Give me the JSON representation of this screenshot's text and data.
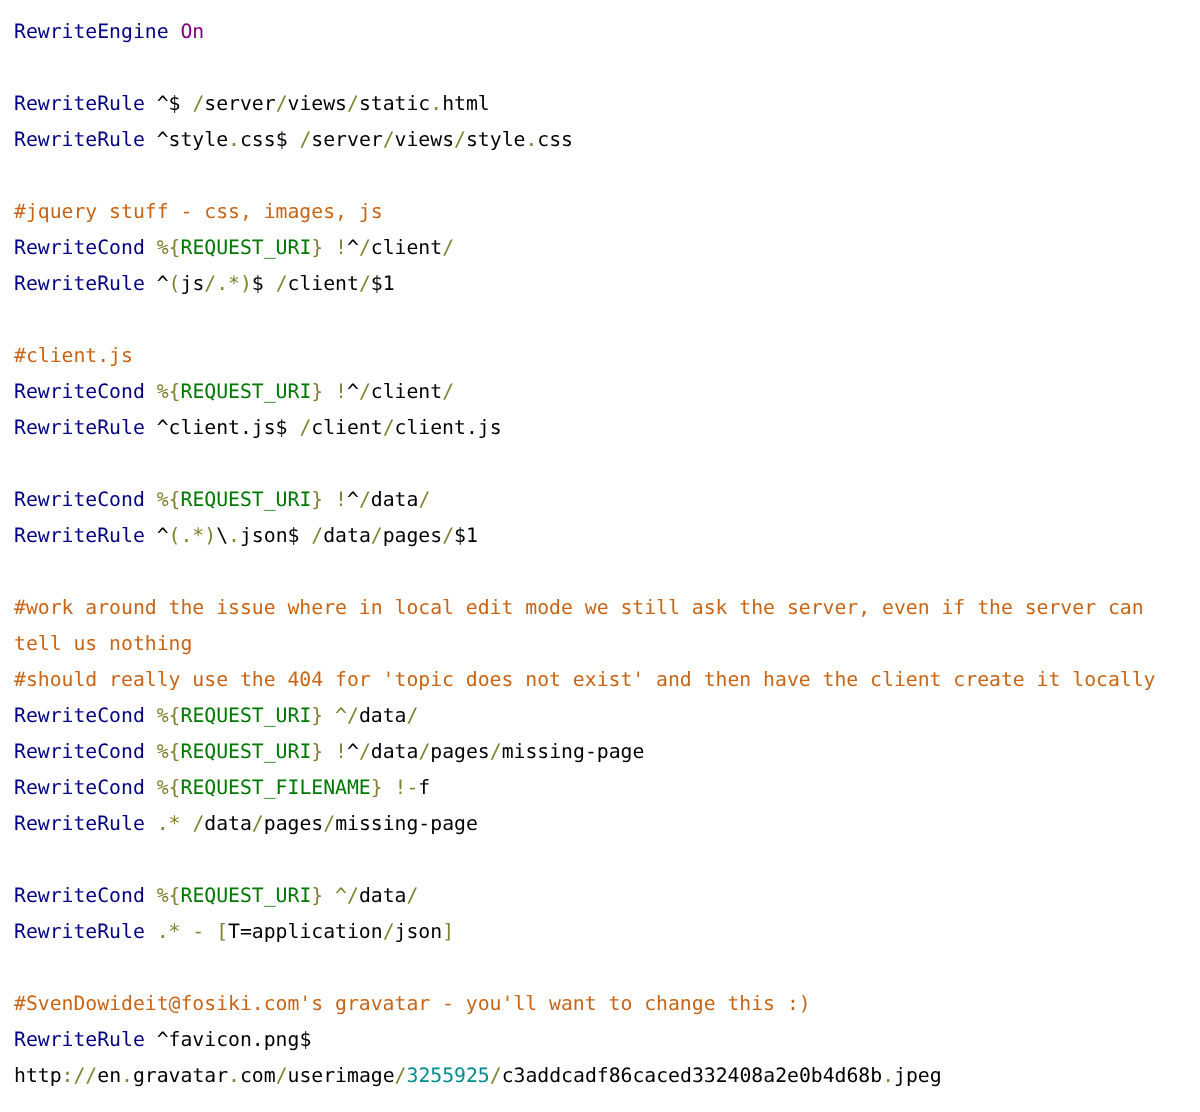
{
  "blocks": [
    {
      "lines": [
        {
          "tokens": [
            {
              "kind": "directive",
              "text": "RewriteEngine"
            },
            {
              "kind": "constant",
              "text": "On",
              "space": true
            }
          ]
        }
      ]
    },
    {
      "lines": [
        {
          "tokens": [
            {
              "kind": "directive",
              "text": "RewriteRule"
            },
            {
              "kind": "text",
              "text": " ^$ "
            },
            {
              "kind": "punct",
              "text": "/"
            },
            {
              "kind": "text",
              "text": "server"
            },
            {
              "kind": "punct",
              "text": "/"
            },
            {
              "kind": "text",
              "text": "views"
            },
            {
              "kind": "punct",
              "text": "/"
            },
            {
              "kind": "text",
              "text": "static"
            },
            {
              "kind": "punct",
              "text": "."
            },
            {
              "kind": "text",
              "text": "html"
            }
          ]
        },
        {
          "tokens": [
            {
              "kind": "directive",
              "text": "RewriteRule"
            },
            {
              "kind": "text",
              "text": " ^style"
            },
            {
              "kind": "punct",
              "text": "."
            },
            {
              "kind": "text",
              "text": "css$ "
            },
            {
              "kind": "punct",
              "text": "/"
            },
            {
              "kind": "text",
              "text": "server"
            },
            {
              "kind": "punct",
              "text": "/"
            },
            {
              "kind": "text",
              "text": "views"
            },
            {
              "kind": "punct",
              "text": "/"
            },
            {
              "kind": "text",
              "text": "style"
            },
            {
              "kind": "punct",
              "text": "."
            },
            {
              "kind": "text",
              "text": "css"
            }
          ]
        }
      ]
    },
    {
      "lines": [
        {
          "tokens": [
            {
              "kind": "comment",
              "text": "#jquery stuff - css, images, js"
            }
          ]
        },
        {
          "tokens": [
            {
              "kind": "directive",
              "text": "RewriteCond"
            },
            {
              "kind": "punct",
              "text": "%{",
              "space": true
            },
            {
              "kind": "variable",
              "text": "REQUEST_URI"
            },
            {
              "kind": "punct",
              "text": "}"
            },
            {
              "kind": "punct",
              "text": "!",
              "space": true
            },
            {
              "kind": "text",
              "text": "^"
            },
            {
              "kind": "punct",
              "text": "/"
            },
            {
              "kind": "text",
              "text": "client"
            },
            {
              "kind": "punct",
              "text": "/"
            }
          ]
        },
        {
          "tokens": [
            {
              "kind": "directive",
              "text": "RewriteRule"
            },
            {
              "kind": "text",
              "text": " ^"
            },
            {
              "kind": "punct",
              "text": "("
            },
            {
              "kind": "text",
              "text": "js"
            },
            {
              "kind": "punct",
              "text": "/.*)"
            },
            {
              "kind": "text",
              "text": "$ "
            },
            {
              "kind": "punct",
              "text": "/"
            },
            {
              "kind": "text",
              "text": "client"
            },
            {
              "kind": "punct",
              "text": "/"
            },
            {
              "kind": "text",
              "text": "$1"
            }
          ]
        }
      ]
    },
    {
      "lines": [
        {
          "tokens": [
            {
              "kind": "comment",
              "text": "#client.js"
            }
          ]
        },
        {
          "tokens": [
            {
              "kind": "directive",
              "text": "RewriteCond"
            },
            {
              "kind": "punct",
              "text": "%{",
              "space": true
            },
            {
              "kind": "variable",
              "text": "REQUEST_URI"
            },
            {
              "kind": "punct",
              "text": "}"
            },
            {
              "kind": "punct",
              "text": "!",
              "space": true
            },
            {
              "kind": "text",
              "text": "^"
            },
            {
              "kind": "punct",
              "text": "/"
            },
            {
              "kind": "text",
              "text": "client"
            },
            {
              "kind": "punct",
              "text": "/"
            }
          ]
        },
        {
          "tokens": [
            {
              "kind": "directive",
              "text": "RewriteRule"
            },
            {
              "kind": "text",
              "text": " ^client.js$ "
            },
            {
              "kind": "punct",
              "text": "/"
            },
            {
              "kind": "text",
              "text": "client"
            },
            {
              "kind": "punct",
              "text": "/"
            },
            {
              "kind": "text",
              "text": "client.js"
            }
          ]
        }
      ]
    },
    {
      "lines": [
        {
          "tokens": [
            {
              "kind": "directive",
              "text": "RewriteCond"
            },
            {
              "kind": "punct",
              "text": "%{",
              "space": true
            },
            {
              "kind": "variable",
              "text": "REQUEST_URI"
            },
            {
              "kind": "punct",
              "text": "}"
            },
            {
              "kind": "punct",
              "text": "!",
              "space": true
            },
            {
              "kind": "text",
              "text": "^"
            },
            {
              "kind": "punct",
              "text": "/"
            },
            {
              "kind": "text",
              "text": "data"
            },
            {
              "kind": "punct",
              "text": "/"
            }
          ]
        },
        {
          "tokens": [
            {
              "kind": "directive",
              "text": "RewriteRule"
            },
            {
              "kind": "text",
              "text": " ^"
            },
            {
              "kind": "punct",
              "text": "(.*)"
            },
            {
              "kind": "text",
              "text": "\\"
            },
            {
              "kind": "punct",
              "text": "."
            },
            {
              "kind": "text",
              "text": "json$ "
            },
            {
              "kind": "punct",
              "text": "/"
            },
            {
              "kind": "text",
              "text": "data"
            },
            {
              "kind": "punct",
              "text": "/"
            },
            {
              "kind": "text",
              "text": "pages"
            },
            {
              "kind": "punct",
              "text": "/"
            },
            {
              "kind": "text",
              "text": "$1"
            }
          ]
        }
      ]
    },
    {
      "lines": [
        {
          "tokens": [
            {
              "kind": "comment",
              "text": "#work around the issue where in local edit mode we still ask the server, even if the server can tell us nothing"
            }
          ]
        },
        {
          "tokens": [
            {
              "kind": "comment",
              "text": "#should really use the 404 for 'topic does not exist' and then have the client create it locally"
            }
          ]
        },
        {
          "tokens": [
            {
              "kind": "directive",
              "text": "RewriteCond"
            },
            {
              "kind": "punct",
              "text": "%{",
              "space": true
            },
            {
              "kind": "variable",
              "text": "REQUEST_URI"
            },
            {
              "kind": "punct",
              "text": "}"
            },
            {
              "kind": "punct",
              "text": "^/",
              "space": true
            },
            {
              "kind": "text",
              "text": "data"
            },
            {
              "kind": "punct",
              "text": "/"
            }
          ]
        },
        {
          "tokens": [
            {
              "kind": "directive",
              "text": "RewriteCond"
            },
            {
              "kind": "punct",
              "text": "%{",
              "space": true
            },
            {
              "kind": "variable",
              "text": "REQUEST_URI"
            },
            {
              "kind": "punct",
              "text": "}"
            },
            {
              "kind": "punct",
              "text": "!",
              "space": true
            },
            {
              "kind": "text",
              "text": "^"
            },
            {
              "kind": "punct",
              "text": "/"
            },
            {
              "kind": "text",
              "text": "data"
            },
            {
              "kind": "punct",
              "text": "/"
            },
            {
              "kind": "text",
              "text": "pages"
            },
            {
              "kind": "punct",
              "text": "/"
            },
            {
              "kind": "text",
              "text": "missing-page"
            }
          ]
        },
        {
          "tokens": [
            {
              "kind": "directive",
              "text": "RewriteCond"
            },
            {
              "kind": "punct",
              "text": "%{",
              "space": true
            },
            {
              "kind": "variable",
              "text": "REQUEST_FILENAME"
            },
            {
              "kind": "punct",
              "text": "}"
            },
            {
              "kind": "punct",
              "text": "!-",
              "space": true
            },
            {
              "kind": "text",
              "text": "f"
            }
          ]
        },
        {
          "tokens": [
            {
              "kind": "directive",
              "text": "RewriteRule"
            },
            {
              "kind": "punct",
              "text": ".*",
              "space": true
            },
            {
              "kind": "punct",
              "text": "/",
              "space": true
            },
            {
              "kind": "text",
              "text": "data"
            },
            {
              "kind": "punct",
              "text": "/"
            },
            {
              "kind": "text",
              "text": "pages"
            },
            {
              "kind": "punct",
              "text": "/"
            },
            {
              "kind": "text",
              "text": "missing-page"
            }
          ]
        }
      ]
    },
    {
      "lines": [
        {
          "tokens": [
            {
              "kind": "directive",
              "text": "RewriteCond"
            },
            {
              "kind": "punct",
              "text": "%{",
              "space": true
            },
            {
              "kind": "variable",
              "text": "REQUEST_URI"
            },
            {
              "kind": "punct",
              "text": "}"
            },
            {
              "kind": "punct",
              "text": "^/",
              "space": true
            },
            {
              "kind": "text",
              "text": "data"
            },
            {
              "kind": "punct",
              "text": "/"
            }
          ]
        },
        {
          "tokens": [
            {
              "kind": "directive",
              "text": "RewriteRule"
            },
            {
              "kind": "punct",
              "text": ".* - [",
              "space": true
            },
            {
              "kind": "text",
              "text": "T=application"
            },
            {
              "kind": "punct",
              "text": "/"
            },
            {
              "kind": "text",
              "text": "json"
            },
            {
              "kind": "punct",
              "text": "]"
            }
          ]
        }
      ]
    },
    {
      "lines": [
        {
          "tokens": [
            {
              "kind": "comment",
              "text": "#SvenDowideit@fosiki.com's gravatar - you'll want to change this :)"
            }
          ]
        },
        {
          "tokens": [
            {
              "kind": "directive",
              "text": "RewriteRule"
            },
            {
              "kind": "text",
              "text": " ^favicon.png$"
            }
          ]
        },
        {
          "tokens": [
            {
              "kind": "text",
              "text": "http"
            },
            {
              "kind": "punct",
              "text": "://"
            },
            {
              "kind": "text",
              "text": "en"
            },
            {
              "kind": "punct",
              "text": "."
            },
            {
              "kind": "text",
              "text": "gravatar"
            },
            {
              "kind": "punct",
              "text": "."
            },
            {
              "kind": "text",
              "text": "com"
            },
            {
              "kind": "punct",
              "text": "/"
            },
            {
              "kind": "text",
              "text": "userimage"
            },
            {
              "kind": "punct",
              "text": "/"
            },
            {
              "kind": "number",
              "text": "3255925"
            },
            {
              "kind": "punct",
              "text": "/"
            },
            {
              "kind": "text",
              "text": "c3addcadf86caced332408a2e0b4d68b"
            },
            {
              "kind": "punct",
              "text": "."
            },
            {
              "kind": "text",
              "text": "jpeg"
            }
          ]
        }
      ]
    }
  ]
}
